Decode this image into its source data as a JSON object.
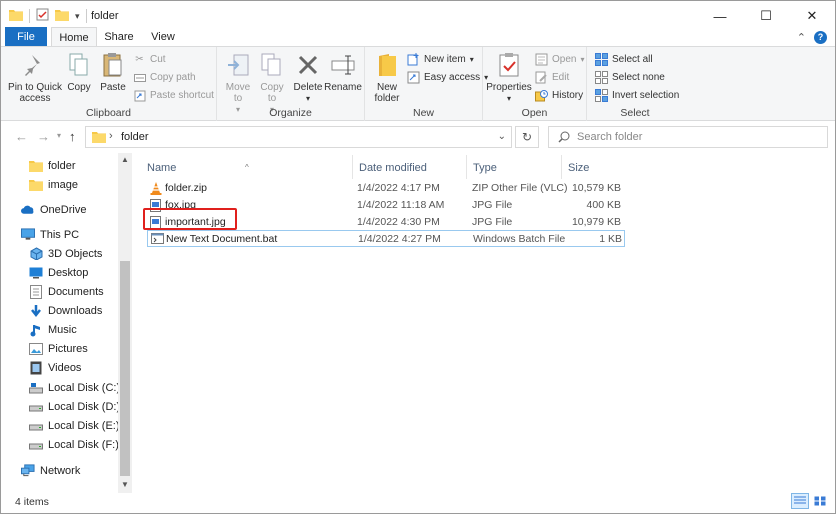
{
  "window": {
    "title": "folder",
    "controls": {
      "minimize": "—",
      "maximize": "☐",
      "close": "✕"
    }
  },
  "ribbon_tabs": {
    "file": "File",
    "home": "Home",
    "share": "Share",
    "view": "View"
  },
  "ribbon": {
    "clipboard": {
      "label": "Clipboard",
      "pin": "Pin to Quick access",
      "copy": "Copy",
      "paste": "Paste",
      "cut": "Cut",
      "copy_path": "Copy path",
      "paste_shortcut": "Paste shortcut"
    },
    "organize": {
      "label": "Organize",
      "move_to": "Move to",
      "copy_to": "Copy to",
      "delete": "Delete",
      "rename": "Rename"
    },
    "new": {
      "label": "New",
      "new_folder": "New folder",
      "new_item": "New item",
      "easy_access": "Easy access"
    },
    "open": {
      "label": "Open",
      "properties": "Properties",
      "open": "Open",
      "edit": "Edit",
      "history": "History"
    },
    "select": {
      "label": "Select",
      "select_all": "Select all",
      "select_none": "Select none",
      "invert_selection": "Invert selection"
    }
  },
  "address": {
    "crumb": "folder",
    "search_placeholder": "Search folder"
  },
  "nav_pane": {
    "items": [
      {
        "label": "folder",
        "icon": "folder-icon"
      },
      {
        "label": "image",
        "icon": "folder-icon"
      },
      {
        "label": "OneDrive",
        "icon": "cloud-icon"
      },
      {
        "label": "This PC",
        "icon": "pc-icon"
      },
      {
        "label": "3D Objects",
        "icon": "cube-icon"
      },
      {
        "label": "Desktop",
        "icon": "desktop-icon"
      },
      {
        "label": "Documents",
        "icon": "documents-icon"
      },
      {
        "label": "Downloads",
        "icon": "download-icon"
      },
      {
        "label": "Music",
        "icon": "music-icon"
      },
      {
        "label": "Pictures",
        "icon": "pictures-icon"
      },
      {
        "label": "Videos",
        "icon": "videos-icon"
      },
      {
        "label": "Local Disk (C:)",
        "icon": "drive-icon"
      },
      {
        "label": "Local Disk (D:)",
        "icon": "drive-icon"
      },
      {
        "label": "Local Disk (E:)",
        "icon": "drive-icon"
      },
      {
        "label": "Local Disk (F:)",
        "icon": "drive-icon"
      },
      {
        "label": "Network",
        "icon": "network-icon"
      }
    ]
  },
  "file_list": {
    "columns": {
      "name": "Name",
      "date": "Date modified",
      "type": "Type",
      "size": "Size"
    },
    "rows": [
      {
        "name": "folder.zip",
        "date": "1/4/2022 4:17 PM",
        "type": "ZIP Other File (VLC)",
        "size": "10,579 KB",
        "icon": "vlc-cone-icon"
      },
      {
        "name": "fox.jpg",
        "date": "1/4/2022 11:18 AM",
        "type": "JPG File",
        "size": "400 KB",
        "icon": "image-file-icon"
      },
      {
        "name": "important.jpg",
        "date": "1/4/2022 4:30 PM",
        "type": "JPG File",
        "size": "10,979 KB",
        "icon": "image-file-icon"
      },
      {
        "name": "New Text Document.bat",
        "date": "1/4/2022 4:27 PM",
        "type": "Windows Batch File",
        "size": "1 KB",
        "icon": "batch-file-icon"
      }
    ]
  },
  "status_bar": {
    "item_count": "4 items"
  },
  "colors": {
    "accent": "#1a6fc3",
    "highlight": "#e0201d",
    "folder": "#f7c948"
  }
}
